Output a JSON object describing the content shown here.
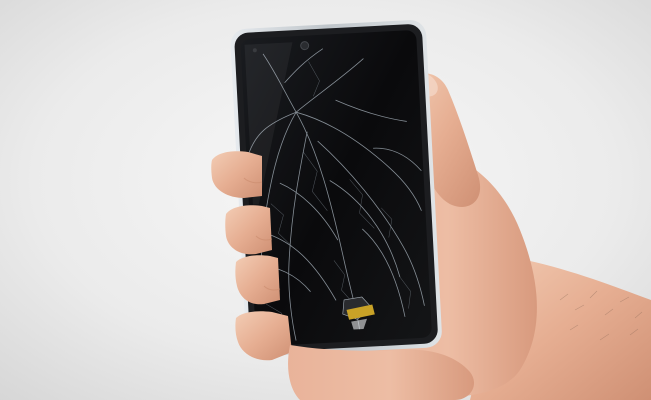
{
  "photo": {
    "subject": "hand-holding-cracked-smartphone",
    "colors": {
      "background_center": "#f6f6f6",
      "background_edge": "#d9d9d9",
      "skin_light": "#f0c7ae",
      "skin_mid": "#e2a98c",
      "skin_shadow": "#c98a6d",
      "phone_frame": "#cfd4d8",
      "screen": "#0d0d0f",
      "crack_lines": "#9aa4ad",
      "debris_accent": "#c9a227"
    }
  }
}
